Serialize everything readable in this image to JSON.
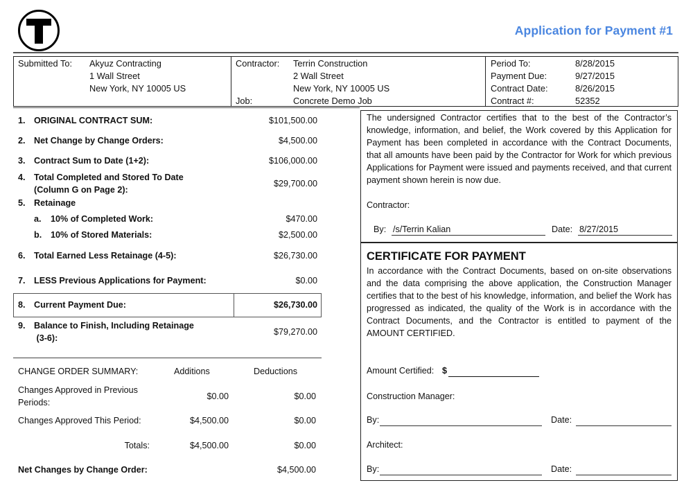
{
  "document": {
    "logo": "T-logo-icon",
    "title": "Application for Payment #1",
    "title_color": "#4a86e0"
  },
  "header": {
    "submitted_to_label": "Submitted To:",
    "submitted_to": [
      "Akyuz Contracting",
      "1 Wall Street",
      "New York, NY 10005 US"
    ],
    "contractor_label": "Contractor:",
    "contractor": [
      "Terrin Construction",
      "2 Wall Street",
      "New York, NY 10005  US"
    ],
    "job_label": "Job:",
    "job": "Concrete Demo Job",
    "period_to_label": "Period To:",
    "period_to": "8/28/2015",
    "payment_due_label": "Payment Due:",
    "payment_due": "9/27/2015",
    "contract_date_label": "Contract Date:",
    "contract_date": "8/26/2015",
    "contract_no_label": "Contract #:",
    "contract_no": "52352"
  },
  "summary": [
    {
      "num": "1.",
      "label": "ORIGINAL CONTRACT SUM:",
      "amount": "$101,500.00"
    },
    {
      "num": "2.",
      "label": "Net Change by Change Orders:",
      "amount": "$4,500.00"
    },
    {
      "num": "3.",
      "label": "Contract Sum to Date (1+2):",
      "amount": "$106,000.00"
    },
    {
      "num": "4.",
      "label": "Total Completed and Stored To Date",
      "label2": "(Column G on Page 2):",
      "amount": "$29,700.00"
    },
    {
      "num": "5.",
      "label": "Retainage"
    },
    {
      "num": "a.",
      "label": "10% of Completed Work:",
      "amount": "$470.00"
    },
    {
      "num": "b.",
      "label": "10% of Stored Materials:",
      "amount": "$2,500.00"
    },
    {
      "num": "6.",
      "label": "Total Earned Less Retainage (4-5):",
      "amount": "$26,730.00"
    },
    {
      "num": "7.",
      "label": "LESS Previous Applications for Payment:",
      "amount": "$0.00"
    },
    {
      "num": "8.",
      "label": "Current Payment Due:",
      "amount": "$26,730.00"
    },
    {
      "num": "9.",
      "label": "Balance to Finish, Including Retainage",
      "label2": " (3-6):",
      "amount": "$79,270.00"
    }
  ],
  "change_orders": {
    "title": "CHANGE ORDER SUMMARY:",
    "col_additions": "Additions",
    "col_deductions": "Deductions",
    "rows": [
      {
        "label": "Changes Approved in Previous",
        "label2": "Periods:",
        "additions": "$0.00",
        "deductions": "$0.00"
      },
      {
        "label": "Changes Approved This Period:",
        "additions": "$4,500.00",
        "deductions": "$0.00"
      }
    ],
    "totals_label": "Totals:",
    "totals_additions": "$4,500.00",
    "totals_deductions": "$0.00",
    "net_label": "Net Changes by Change Order:",
    "net_amount": "$4,500.00"
  },
  "contractor_cert": {
    "text": "The undersigned Contractor certifies that to the best of the Contractor’s knowledge, information, and belief, the Work covered by this Application for Payment has been completed in accordance with the Contract Documents, that all amounts have been paid by the Contractor for Work for which previous Applications for Payment were issued and payments received, and that current payment shown herein is now due.",
    "contractor_label": "Contractor:",
    "by_label": "By:",
    "by_value": "/s/Terrin Kalian",
    "date_label": "Date:",
    "date_value": "8/27/2015"
  },
  "certificate": {
    "title": "CERTIFICATE FOR PAYMENT",
    "text": "In accordance with the Contract Documents, based on on-site observations and the data comprising the above application, the Construction Manager certifies that to the best of his knowledge, information, and belief the Work has progressed as indicated, the quality of the Work is in accordance with the Contract Documents, and the Contractor is entitled to payment of the AMOUNT CERTIFIED.",
    "amount_label": "Amount Certified:",
    "amount_currency": "$",
    "amount_value": "",
    "cm_label": "Construction Manager:",
    "cm_by_label": "By:",
    "cm_by_value": "",
    "cm_date_label": "Date:",
    "cm_date_value": "",
    "architect_label": "Architect:",
    "arch_by_label": "By:",
    "arch_by_value": "",
    "arch_date_label": "Date:",
    "arch_date_value": ""
  }
}
